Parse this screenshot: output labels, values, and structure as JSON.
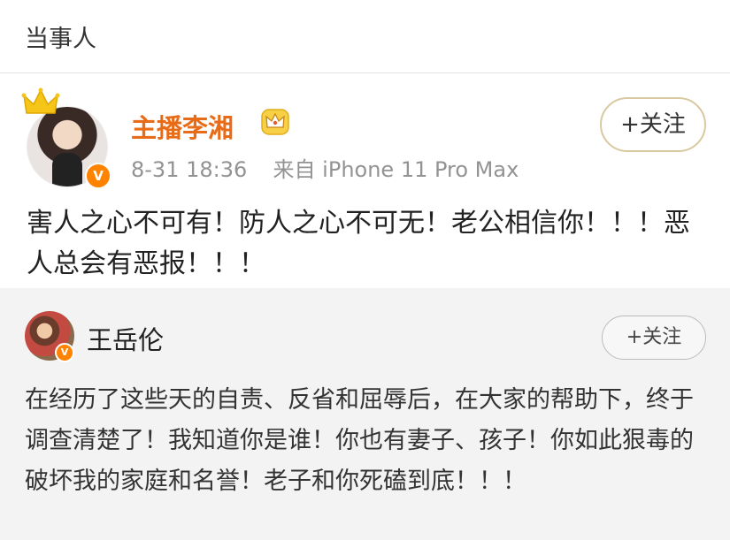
{
  "header": {
    "title": "当事人"
  },
  "post1": {
    "author": "主播李湘",
    "verified_badge": "V",
    "timestamp": "8-31 18:36",
    "source": "来自 iPhone 11 Pro Max",
    "follow_label": "+关注",
    "content": "害人之心不可有！防人之心不可无！老公相信你！！！恶人总会有恶报！！！",
    "icons": [
      "crown-icon",
      "vip-crown-icon"
    ]
  },
  "post2": {
    "author": "王岳伦",
    "verified_badge": "V",
    "follow_label": "+关注",
    "content": "在经历了这些天的自责、反省和屈辱后，在大家的帮助下，终于调查清楚了！我知道你是谁！你也有妻子、孩子！你如此狠毒的破坏我的家庭和名誉！老子和你死磕到底！！！"
  },
  "colors": {
    "vip_name": "#e86b18",
    "verified_badge": "#ff8200",
    "follow_border_gold": "#d9c9a0",
    "repost_bg": "#f3f3f3"
  }
}
